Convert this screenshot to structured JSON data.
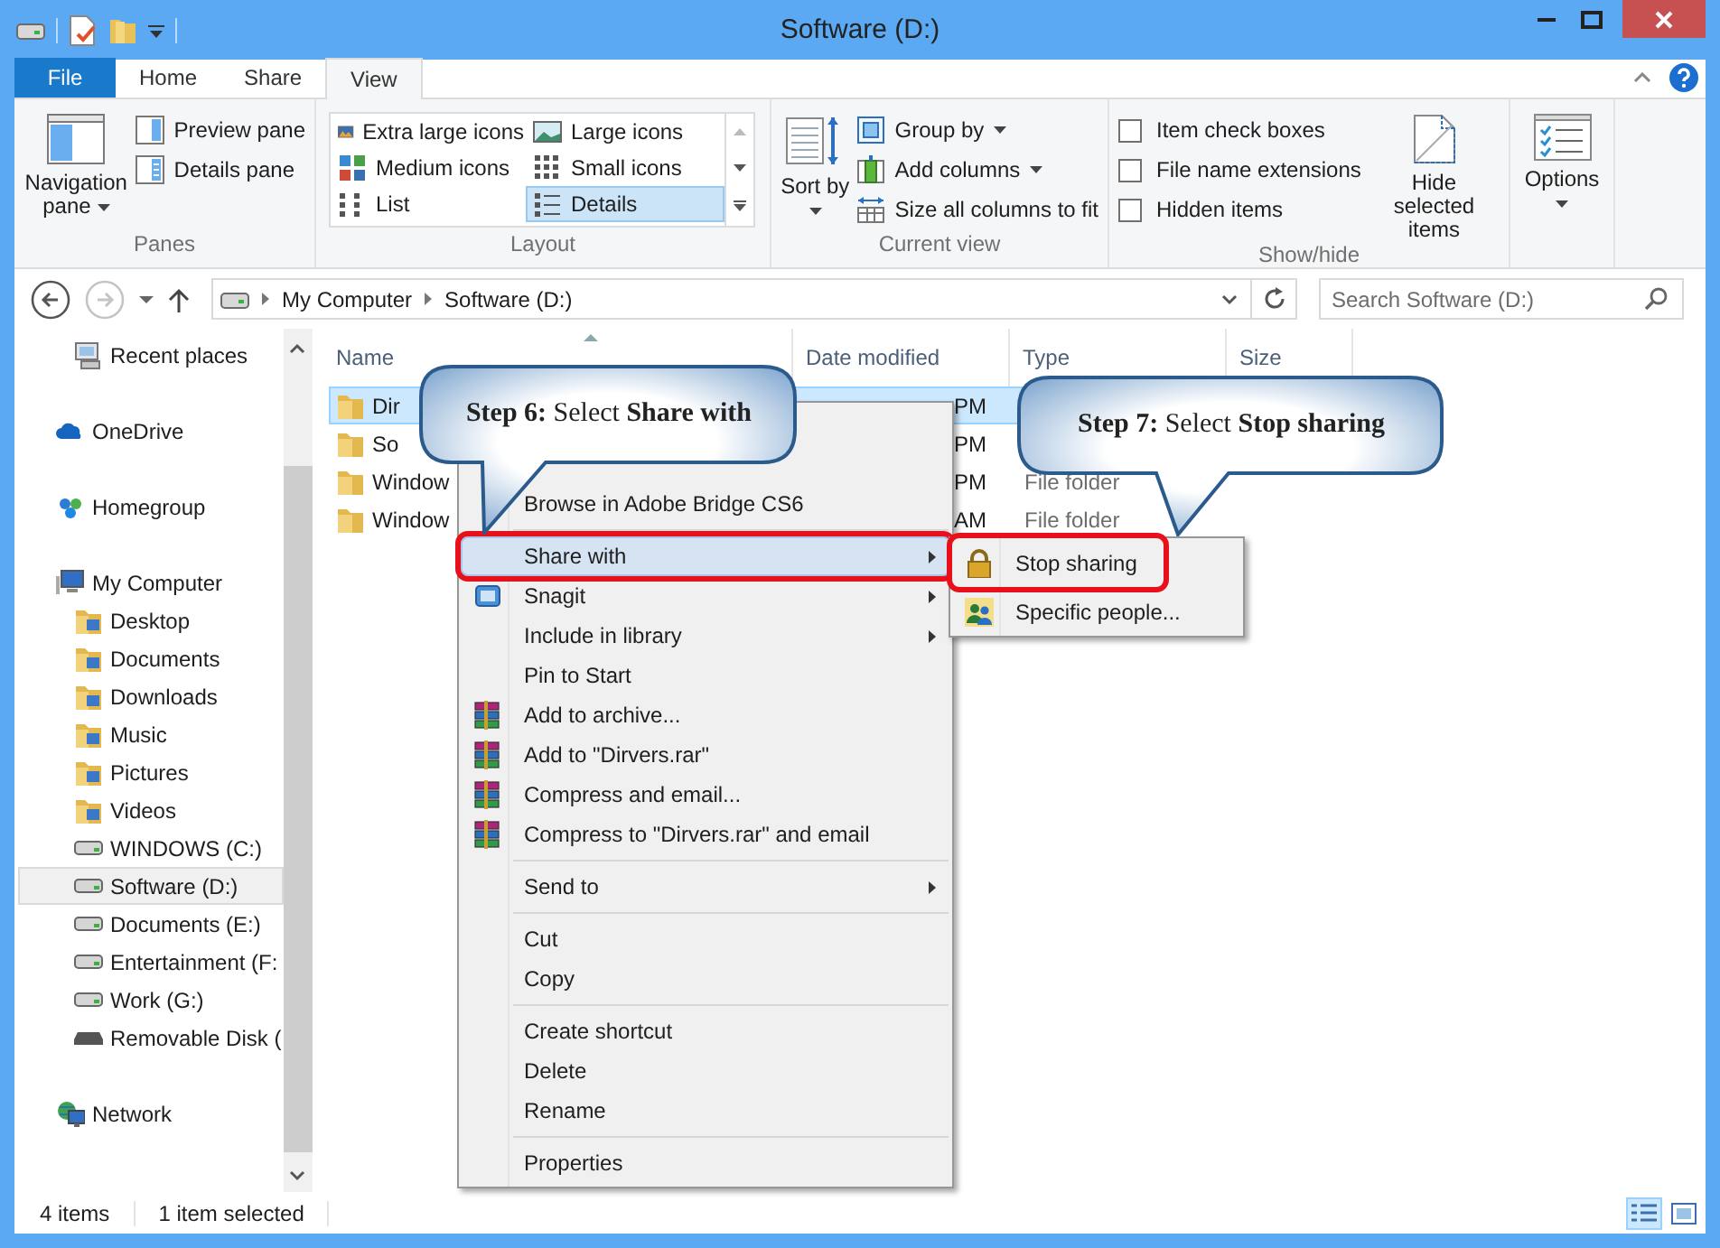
{
  "window": {
    "title": "Software (D:)"
  },
  "ribbon": {
    "tabs": [
      {
        "label": "File",
        "kind": "file",
        "selected": false
      },
      {
        "label": "Home",
        "kind": "tab",
        "selected": false
      },
      {
        "label": "Share",
        "kind": "tab",
        "selected": false
      },
      {
        "label": "View",
        "kind": "tab",
        "selected": true
      }
    ],
    "panes": {
      "label": "Panes",
      "navigation_pane": "Navigation pane",
      "preview_pane": "Preview pane",
      "details_pane": "Details pane"
    },
    "layout": {
      "label": "Layout",
      "options": [
        {
          "label": "Extra large icons",
          "selected": false
        },
        {
          "label": "Large icons",
          "selected": false
        },
        {
          "label": "Medium icons",
          "selected": false
        },
        {
          "label": "Small icons",
          "selected": false
        },
        {
          "label": "List",
          "selected": false
        },
        {
          "label": "Details",
          "selected": true
        }
      ]
    },
    "current_view": {
      "label": "Current view",
      "sort_by": "Sort by",
      "group_by": "Group by",
      "add_columns": "Add columns",
      "size_all_columns": "Size all columns to fit"
    },
    "show_hide": {
      "label": "Show/hide",
      "options": [
        {
          "label": "Item check boxes",
          "checked": false
        },
        {
          "label": "File name extensions",
          "checked": false
        },
        {
          "label": "Hidden items",
          "checked": false
        }
      ],
      "hide_selected": "Hide selected items"
    },
    "options": {
      "label": "Options"
    }
  },
  "address_bar": {
    "path": [
      "My Computer",
      "Software (D:)"
    ],
    "search": {
      "placeholder": "Search Software (D:)"
    }
  },
  "navigation": {
    "favorites": [
      {
        "label": "Recent places",
        "kind": "recent",
        "selected": false
      }
    ],
    "items": [
      {
        "label": "OneDrive",
        "kind": "cloud",
        "selected": false
      },
      {
        "label": "Homegroup",
        "kind": "homegroup",
        "selected": false
      },
      {
        "label": "My Computer",
        "kind": "computer",
        "selected": false,
        "children": [
          {
            "label": "Desktop",
            "kind": "folder",
            "selected": false
          },
          {
            "label": "Documents",
            "kind": "folder",
            "selected": false
          },
          {
            "label": "Downloads",
            "kind": "folder",
            "selected": false
          },
          {
            "label": "Music",
            "kind": "folder",
            "selected": false
          },
          {
            "label": "Pictures",
            "kind": "folder",
            "selected": false
          },
          {
            "label": "Videos",
            "kind": "folder",
            "selected": false
          },
          {
            "label": "WINDOWS (C:)",
            "kind": "drive",
            "selected": false
          },
          {
            "label": "Software (D:)",
            "kind": "drive",
            "selected": true
          },
          {
            "label": "Documents (E:)",
            "kind": "drive",
            "selected": false
          },
          {
            "label": "Entertainment (F:",
            "kind": "drive",
            "selected": false
          },
          {
            "label": "Work (G:)",
            "kind": "drive",
            "selected": false
          },
          {
            "label": "Removable Disk (",
            "kind": "removable",
            "selected": false
          }
        ]
      },
      {
        "label": "Network",
        "kind": "network",
        "selected": false
      }
    ]
  },
  "files": {
    "columns": [
      "Name",
      "Date modified",
      "Type",
      "Size"
    ],
    "rows": [
      {
        "name": "Dir",
        "date": "PM",
        "selected": true
      },
      {
        "name": "So",
        "date": "PM",
        "selected": false
      },
      {
        "name": "Window",
        "date": "PM",
        "type": "File folder",
        "selected": false
      },
      {
        "name": "Window",
        "date": "AM",
        "type": "File folder",
        "selected": false
      }
    ]
  },
  "context_menu": {
    "items": [
      {
        "label": "Browse in Adobe Bridge CS6",
        "kind": "plain",
        "submenu": false,
        "selected": false,
        "marked": false
      },
      {
        "kind": "separator"
      },
      {
        "label": "Share with",
        "kind": "plain",
        "submenu": true,
        "selected": true,
        "marked": true
      },
      {
        "label": "Snagit",
        "kind": "snagit",
        "submenu": true,
        "selected": false,
        "marked": false
      },
      {
        "label": "Include in library",
        "kind": "plain",
        "submenu": true,
        "selected": false,
        "marked": false
      },
      {
        "label": "Pin to Start",
        "kind": "plain",
        "submenu": false,
        "selected": false,
        "marked": false
      },
      {
        "label": "Add to archive...",
        "kind": "archive",
        "submenu": false,
        "selected": false,
        "marked": false
      },
      {
        "label": "Add to \"Dirvers.rar\"",
        "kind": "archive",
        "submenu": false,
        "selected": false,
        "marked": false
      },
      {
        "label": "Compress and email...",
        "kind": "archive",
        "submenu": false,
        "selected": false,
        "marked": false
      },
      {
        "label": "Compress to \"Dirvers.rar\" and email",
        "kind": "archive",
        "submenu": false,
        "selected": false,
        "marked": false
      },
      {
        "kind": "separator"
      },
      {
        "label": "Send to",
        "kind": "plain",
        "submenu": true,
        "selected": false,
        "marked": false
      },
      {
        "kind": "separator"
      },
      {
        "label": "Cut",
        "kind": "plain",
        "submenu": false,
        "selected": false,
        "marked": false
      },
      {
        "label": "Copy",
        "kind": "plain",
        "submenu": false,
        "selected": false,
        "marked": false
      },
      {
        "kind": "separator"
      },
      {
        "label": "Create shortcut",
        "kind": "plain",
        "submenu": false,
        "selected": false,
        "marked": false
      },
      {
        "label": "Delete",
        "kind": "plain",
        "submenu": false,
        "selected": false,
        "marked": false
      },
      {
        "label": "Rename",
        "kind": "plain",
        "submenu": false,
        "selected": false,
        "marked": false
      },
      {
        "kind": "separator"
      },
      {
        "label": "Properties",
        "kind": "plain",
        "submenu": false,
        "selected": false,
        "marked": false
      }
    ]
  },
  "submenu": {
    "items": [
      {
        "label": "Stop sharing",
        "kind": "lock",
        "selected": false,
        "marked": true
      },
      {
        "label": "Specific people...",
        "kind": "people",
        "selected": false,
        "marked": false
      }
    ]
  },
  "callouts": [
    "**Step 6:** Select **Share with**",
    "**Step 7:** Select **Stop sharing**"
  ],
  "status_bar": {
    "items": [
      "4 items",
      "1 item selected"
    ],
    "views": [
      {
        "kind": "details",
        "selected": true
      },
      {
        "kind": "large_icons",
        "selected": false
      }
    ]
  }
}
